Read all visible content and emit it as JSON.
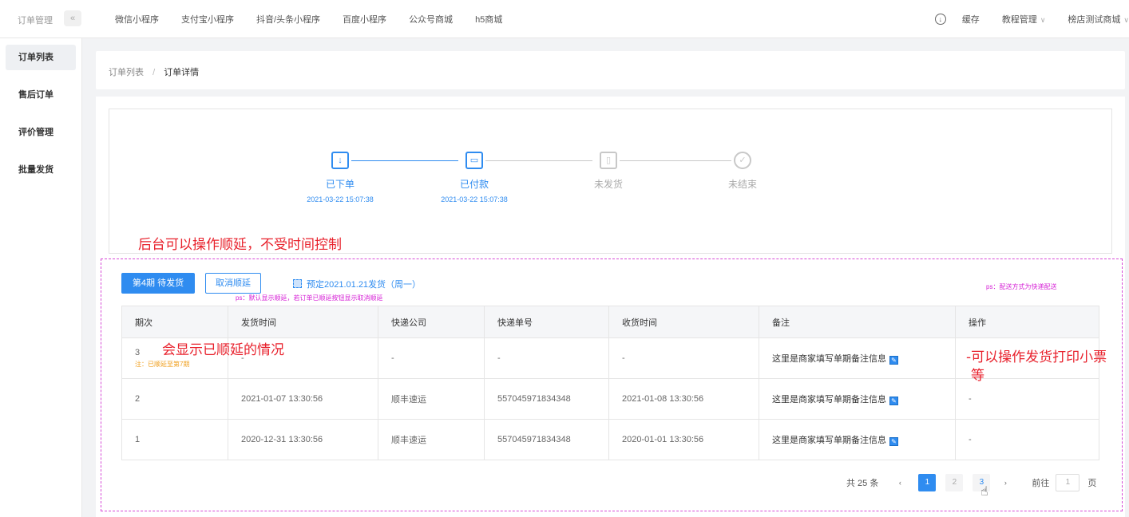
{
  "topbar": {
    "brand": "订单管理",
    "collapse": "«",
    "nav": [
      "微信小程序",
      "支付宝小程序",
      "抖音/头条小程序",
      "百度小程序",
      "公众号商城",
      "h5商城"
    ],
    "right": {
      "cache": "缓存",
      "tutorial": "教程管理",
      "shop": "榜店测试商城",
      "chevron": "∨"
    }
  },
  "sidebar": {
    "items": [
      {
        "label": "订单列表",
        "active": true
      },
      {
        "label": "售后订单"
      },
      {
        "label": "评价管理"
      },
      {
        "label": "批量发货"
      }
    ]
  },
  "breadcrumb": {
    "parent": "订单列表",
    "separator": "/",
    "current": "订单详情"
  },
  "steps": [
    {
      "label": "已下单",
      "time": "2021-03-22 15:07:38",
      "done": true
    },
    {
      "label": "已付款",
      "time": "2021-03-22 15:07:38",
      "done": true
    },
    {
      "label": "未发货",
      "time": "",
      "done": false
    },
    {
      "label": "未结束",
      "time": "",
      "done": false
    }
  ],
  "annotations": {
    "delay": "后台可以操作顺延，不受时间控制",
    "row": "会显示已顺延的情况",
    "ops_line1": "-可以操作发货打印小票",
    "ops_line2": "等",
    "ps_default": "ps：默认显示顺延，若订单已顺延按钮显示取消顺延",
    "ps_delivery": "ps：配送方式为快递配送"
  },
  "actions": {
    "period_button": "第4期 待发货",
    "cancel_button": "取消顺延",
    "schedule": "预定2021.01.21发货（周一）"
  },
  "table": {
    "headers": [
      "期次",
      "发货时间",
      "快递公司",
      "快递单号",
      "收货时间",
      "备注",
      "操作"
    ],
    "rows": [
      {
        "period": "3",
        "period_note": "注：已顺延至第7期",
        "ship_time": "-",
        "company": "-",
        "tracking": "-",
        "receive_time": "-",
        "remark": "这里是商家填写单期备注信息",
        "op": ""
      },
      {
        "period": "2",
        "period_note": "",
        "ship_time": "2021-01-07 13:30:56",
        "company": "顺丰速运",
        "tracking": "557045971834348",
        "receive_time": "2021-01-08 13:30:56",
        "remark": "这里是商家填写单期备注信息",
        "op": "-"
      },
      {
        "period": "1",
        "period_note": "",
        "ship_time": "2020-12-31 13:30:56",
        "company": "顺丰速运",
        "tracking": "557045971834348",
        "receive_time": "2020-01-01 13:30:56",
        "remark": "这里是商家填写单期备注信息",
        "op": "-"
      }
    ]
  },
  "pagination": {
    "total": "共 25 条",
    "prev": "‹",
    "pages": [
      "1",
      "2",
      "3"
    ],
    "current": "1",
    "next": "›",
    "goto_label": "前往",
    "goto_value": "1",
    "page_suffix": "页"
  },
  "colors": {
    "accent": "#2f8cf0",
    "annotation": "#e8212c",
    "dashed": "#d64bd6"
  }
}
